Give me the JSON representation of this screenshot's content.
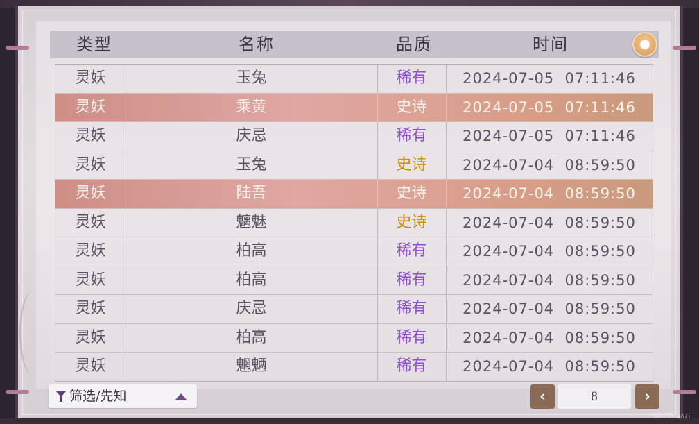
{
  "header": {
    "col_type": "类型",
    "col_name": "名称",
    "col_quality": "品质",
    "col_time": "时间"
  },
  "rows": [
    {
      "type": "灵妖",
      "name": "玉兔",
      "quality": "稀有",
      "date": "2024-07-05",
      "time": "07:11:46"
    },
    {
      "type": "灵妖",
      "name": "乘黄",
      "quality": "史诗",
      "date": "2024-07-05",
      "time": "07:11:46"
    },
    {
      "type": "灵妖",
      "name": "庆忌",
      "quality": "稀有",
      "date": "2024-07-05",
      "time": "07:11:46"
    },
    {
      "type": "灵妖",
      "name": "玉兔",
      "quality": "史诗",
      "date": "2024-07-04",
      "time": "08:59:50"
    },
    {
      "type": "灵妖",
      "name": "陆吾",
      "quality": "史诗",
      "date": "2024-07-04",
      "time": "08:59:50"
    },
    {
      "type": "灵妖",
      "name": "魑魅",
      "quality": "史诗",
      "date": "2024-07-04",
      "time": "08:59:50"
    },
    {
      "type": "灵妖",
      "name": "柏高",
      "quality": "稀有",
      "date": "2024-07-04",
      "time": "08:59:50"
    },
    {
      "type": "灵妖",
      "name": "柏高",
      "quality": "稀有",
      "date": "2024-07-04",
      "time": "08:59:50"
    },
    {
      "type": "灵妖",
      "name": "庆忌",
      "quality": "稀有",
      "date": "2024-07-04",
      "time": "08:59:50"
    },
    {
      "type": "灵妖",
      "name": "柏高",
      "quality": "稀有",
      "date": "2024-07-04",
      "time": "08:59:50"
    },
    {
      "type": "灵妖",
      "name": "魍魉",
      "quality": "稀有",
      "date": "2024-07-04",
      "time": "08:59:50"
    }
  ],
  "filter": {
    "label": "筛选/先知"
  },
  "pagination": {
    "page": "8",
    "prev_icon": "‹",
    "next_icon": "›"
  },
  "info_icon": "lightbulb-icon",
  "colors": {
    "rare": "#8a4fc9",
    "epic": "#c98c0b",
    "highlight": "#d89d86",
    "page_button": "#8b6a55"
  },
  "watermark": "激活 Wi"
}
